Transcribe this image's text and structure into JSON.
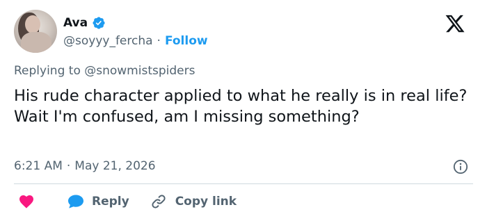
{
  "author": {
    "name": "Ava",
    "handle": "@soyyy_fercha",
    "separator": "·",
    "follow_label": "Follow",
    "verified": true
  },
  "platform": {
    "logo_icon": "x-logo-icon"
  },
  "reply_context": {
    "prefix": "Replying to ",
    "mention": "@snowmistspiders"
  },
  "tweet": {
    "text": "His rude character applied to what he really is in real life? Wait I'm confused, am I missing something?"
  },
  "meta": {
    "time": "6:21 AM",
    "separator": "·",
    "date": "May 21, 2026"
  },
  "actions": {
    "like_icon": "heart-icon",
    "reply_label": "Reply",
    "copy_link_label": "Copy link"
  },
  "colors": {
    "accent": "#1d9bf0",
    "like": "#f91880",
    "text": "#0f1419",
    "muted": "#536471",
    "divider": "#cfd9de"
  }
}
